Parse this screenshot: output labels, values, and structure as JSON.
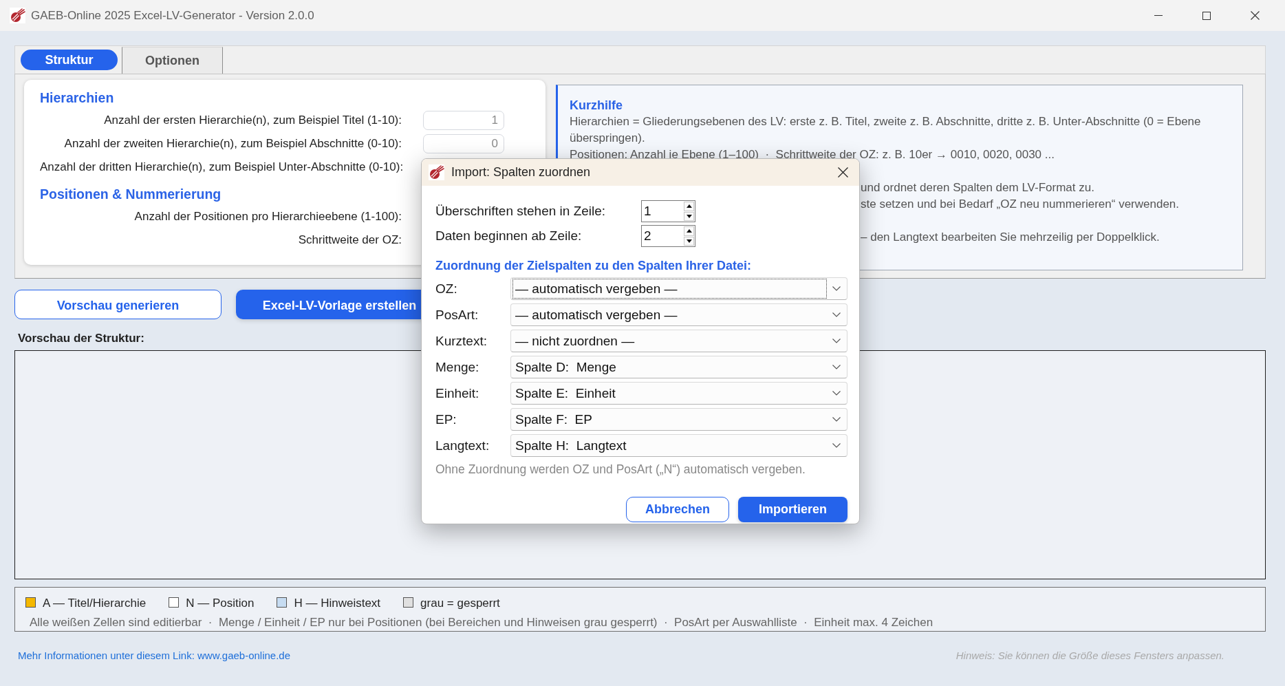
{
  "window": {
    "title": "GAEB-Online 2025 Excel-LV-Generator - Version 2.0.0"
  },
  "tabs": [
    {
      "label": "Struktur",
      "selected": true
    },
    {
      "label": "Optionen",
      "selected": false
    }
  ],
  "structure": {
    "sections": [
      {
        "heading": "Hierarchien",
        "fields": [
          {
            "label": "Anzahl der ersten Hierarchie(n), zum Beispiel Titel (1-10):",
            "placeholder": "1"
          },
          {
            "label": "Anzahl der zweiten Hierarchie(n), zum Beispiel Abschnitte (0-10):",
            "placeholder": "0"
          },
          {
            "label": "Anzahl der dritten Hierarchie(n), zum Beispiel Unter-Abschnitte (0-10):"
          }
        ]
      },
      {
        "heading": "Positionen & Nummerierung",
        "fields": [
          {
            "label": "Anzahl der Positionen pro Hierarchieebene (1-100):"
          },
          {
            "label": "Schrittweite der OZ:"
          }
        ]
      }
    ]
  },
  "help": {
    "title": "Kurzhilfe",
    "paragraphs": [
      {
        "kind": "text",
        "text": "Hierarchien = Gliederungsebenen des LV: erste z. B. Titel, zweite z. B. Abschnitte, dritte z. B. Unter-Abschnitte (0 = Ebene überspringen)."
      },
      {
        "kind": "text",
        "text": "Positionen: Anzahl je Ebene (1–100)  ·  Schrittweite der OZ: z. B. 10er → 0010, 0020, 0030 ..."
      },
      {
        "kind": "covered",
        "lines": [
          "und ordnet deren Spalten dem LV-Format zu.",
          "ste setzen und bei Bedarf „OZ neu nummerieren“ verwenden."
        ]
      },
      {
        "kind": "covered",
        "lines": [
          "– den Langtext bearbeiten Sie mehrzeilig per Doppelklick."
        ]
      }
    ]
  },
  "actions": [
    {
      "label": "Vorschau generieren",
      "kind": "secondary"
    },
    {
      "label": "Excel-LV-Vorlage erstellen",
      "kind": "primary"
    }
  ],
  "preview": {
    "label": "Vorschau der Struktur:"
  },
  "legend": {
    "items": [
      {
        "label": "A — Titel/Hierarchie",
        "color": "#f5b800"
      },
      {
        "label": "N — Position",
        "color": "#ffffff"
      },
      {
        "label": "H — Hinweistext",
        "color": "#c6dcf2"
      },
      {
        "label": "grau = gesperrt",
        "color": "#e0e0e0"
      }
    ],
    "note": "Alle weißen Zellen sind editierbar  ·  Menge / Einheit / EP nur bei Positionen (bei Bereichen und Hinweisen grau gesperrt)  ·  PosArt per Auswahlliste  ·  Einheit max. 4 Zeichen"
  },
  "footer": {
    "link": "Mehr Informationen unter diesem Link: www.gaeb-online.de",
    "hint": "Hinweis: Sie können die Größe dieses Fensters anpassen."
  },
  "dialog": {
    "title": "Import: Spalten zuordnen",
    "row_fields": [
      {
        "label": "Überschriften stehen in Zeile:",
        "value": "1"
      },
      {
        "label": "Daten beginnen ab Zeile:",
        "value": "2"
      }
    ],
    "mapping_heading": "Zuordnung der Zielspalten zu den Spalten Ihrer Datei:",
    "mappings": [
      {
        "label": "OZ:",
        "value": "— automatisch vergeben —",
        "focused": true
      },
      {
        "label": "PosArt:",
        "value": "— automatisch vergeben —",
        "focused": false
      },
      {
        "label": "Kurztext:",
        "value": "— nicht zuordnen —",
        "focused": false
      },
      {
        "label": "Menge:",
        "value": "Spalte D:  Menge",
        "focused": false
      },
      {
        "label": "Einheit:",
        "value": "Spalte E:  Einheit",
        "focused": false
      },
      {
        "label": "EP:",
        "value": "Spalte F:  EP",
        "focused": false
      },
      {
        "label": "Langtext:",
        "value": "Spalte H:  Langtext",
        "focused": false
      }
    ],
    "hint": "Ohne Zuordnung werden OZ und PosArt („N“) automatisch vergeben.",
    "buttons": [
      {
        "label": "Abbrechen",
        "kind": "secondary"
      },
      {
        "label": "Importieren",
        "kind": "primary"
      }
    ]
  }
}
